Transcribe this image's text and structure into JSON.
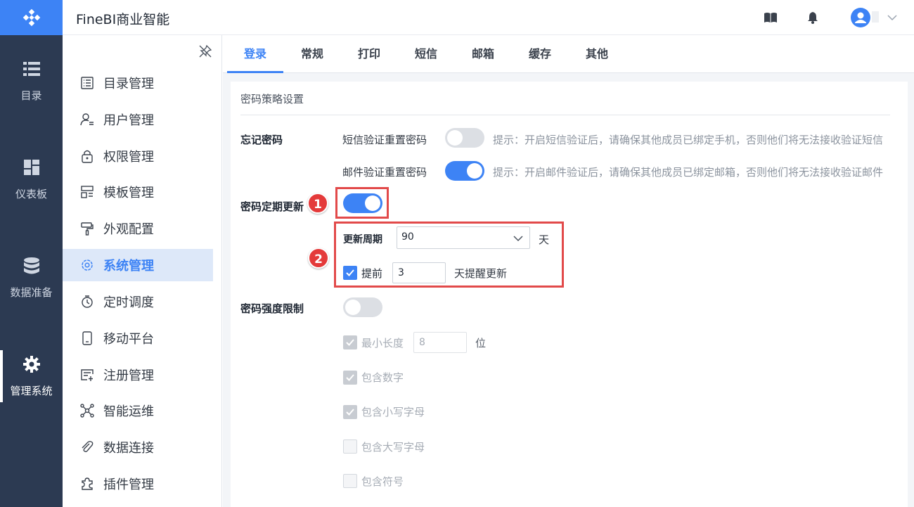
{
  "app_title": "FineBI商业智能",
  "colors": {
    "accent": "#3d83f5",
    "rail_bg": "#2c3a52",
    "highlight_red": "#e24a4a"
  },
  "rail": [
    {
      "label": "目录",
      "icon": "list-icon"
    },
    {
      "label": "仪表板",
      "icon": "dashboard-icon"
    },
    {
      "label": "数据准备",
      "icon": "database-icon"
    },
    {
      "label": "管理系统",
      "icon": "gear-icon",
      "active": true
    }
  ],
  "header": {
    "icons": [
      "book-icon",
      "bell-icon",
      "avatar",
      "chevron-down-icon"
    ]
  },
  "sidebar": {
    "items": [
      {
        "label": "目录管理",
        "icon": "catalog-icon"
      },
      {
        "label": "用户管理",
        "icon": "user-icon"
      },
      {
        "label": "权限管理",
        "icon": "lock-icon"
      },
      {
        "label": "模板管理",
        "icon": "template-icon"
      },
      {
        "label": "外观配置",
        "icon": "paint-roller-icon"
      },
      {
        "label": "系统管理",
        "icon": "gear-icon",
        "active": true
      },
      {
        "label": "定时调度",
        "icon": "stopwatch-icon"
      },
      {
        "label": "移动平台",
        "icon": "mobile-icon"
      },
      {
        "label": "注册管理",
        "icon": "register-icon"
      },
      {
        "label": "智能运维",
        "icon": "network-icon"
      },
      {
        "label": "数据连接",
        "icon": "paperclip-icon"
      },
      {
        "label": "插件管理",
        "icon": "puzzle-icon"
      }
    ]
  },
  "tabs": [
    {
      "label": "登录",
      "active": true
    },
    {
      "label": "常规"
    },
    {
      "label": "打印"
    },
    {
      "label": "短信"
    },
    {
      "label": "邮箱"
    },
    {
      "label": "缓存"
    },
    {
      "label": "其他"
    }
  ],
  "panel": {
    "section_title": "密码策略设置",
    "forgot_password": {
      "label": "忘记密码",
      "sms": {
        "label": "短信验证重置密码",
        "enabled": false,
        "hint": "提示：开启短信验证后，请确保其他成员已绑定手机，否则他们将无法接收验证短信"
      },
      "email": {
        "label": "邮件验证重置密码",
        "enabled": true,
        "hint": "提示：开启邮件验证后，请确保其他成员已绑定邮箱，否则他们将无法接收验证邮件"
      }
    },
    "periodic_update": {
      "label": "密码定期更新",
      "enabled": true,
      "badge": "1",
      "badge2": "2",
      "period_label": "更新周期",
      "period_value": "90",
      "period_unit": "天",
      "remind_checked": true,
      "remind_label": "提前",
      "remind_value": "3",
      "remind_suffix": "天提醒更新"
    },
    "strength": {
      "label": "密码强度限制",
      "enabled": false,
      "min_length_label": "最小长度",
      "min_length_value": "8",
      "min_length_unit": "位",
      "options": [
        {
          "label": "包含数字",
          "checked": true
        },
        {
          "label": "包含小写字母",
          "checked": true
        },
        {
          "label": "包含大写字母",
          "checked": false
        },
        {
          "label": "包含符号",
          "checked": false
        }
      ]
    }
  }
}
